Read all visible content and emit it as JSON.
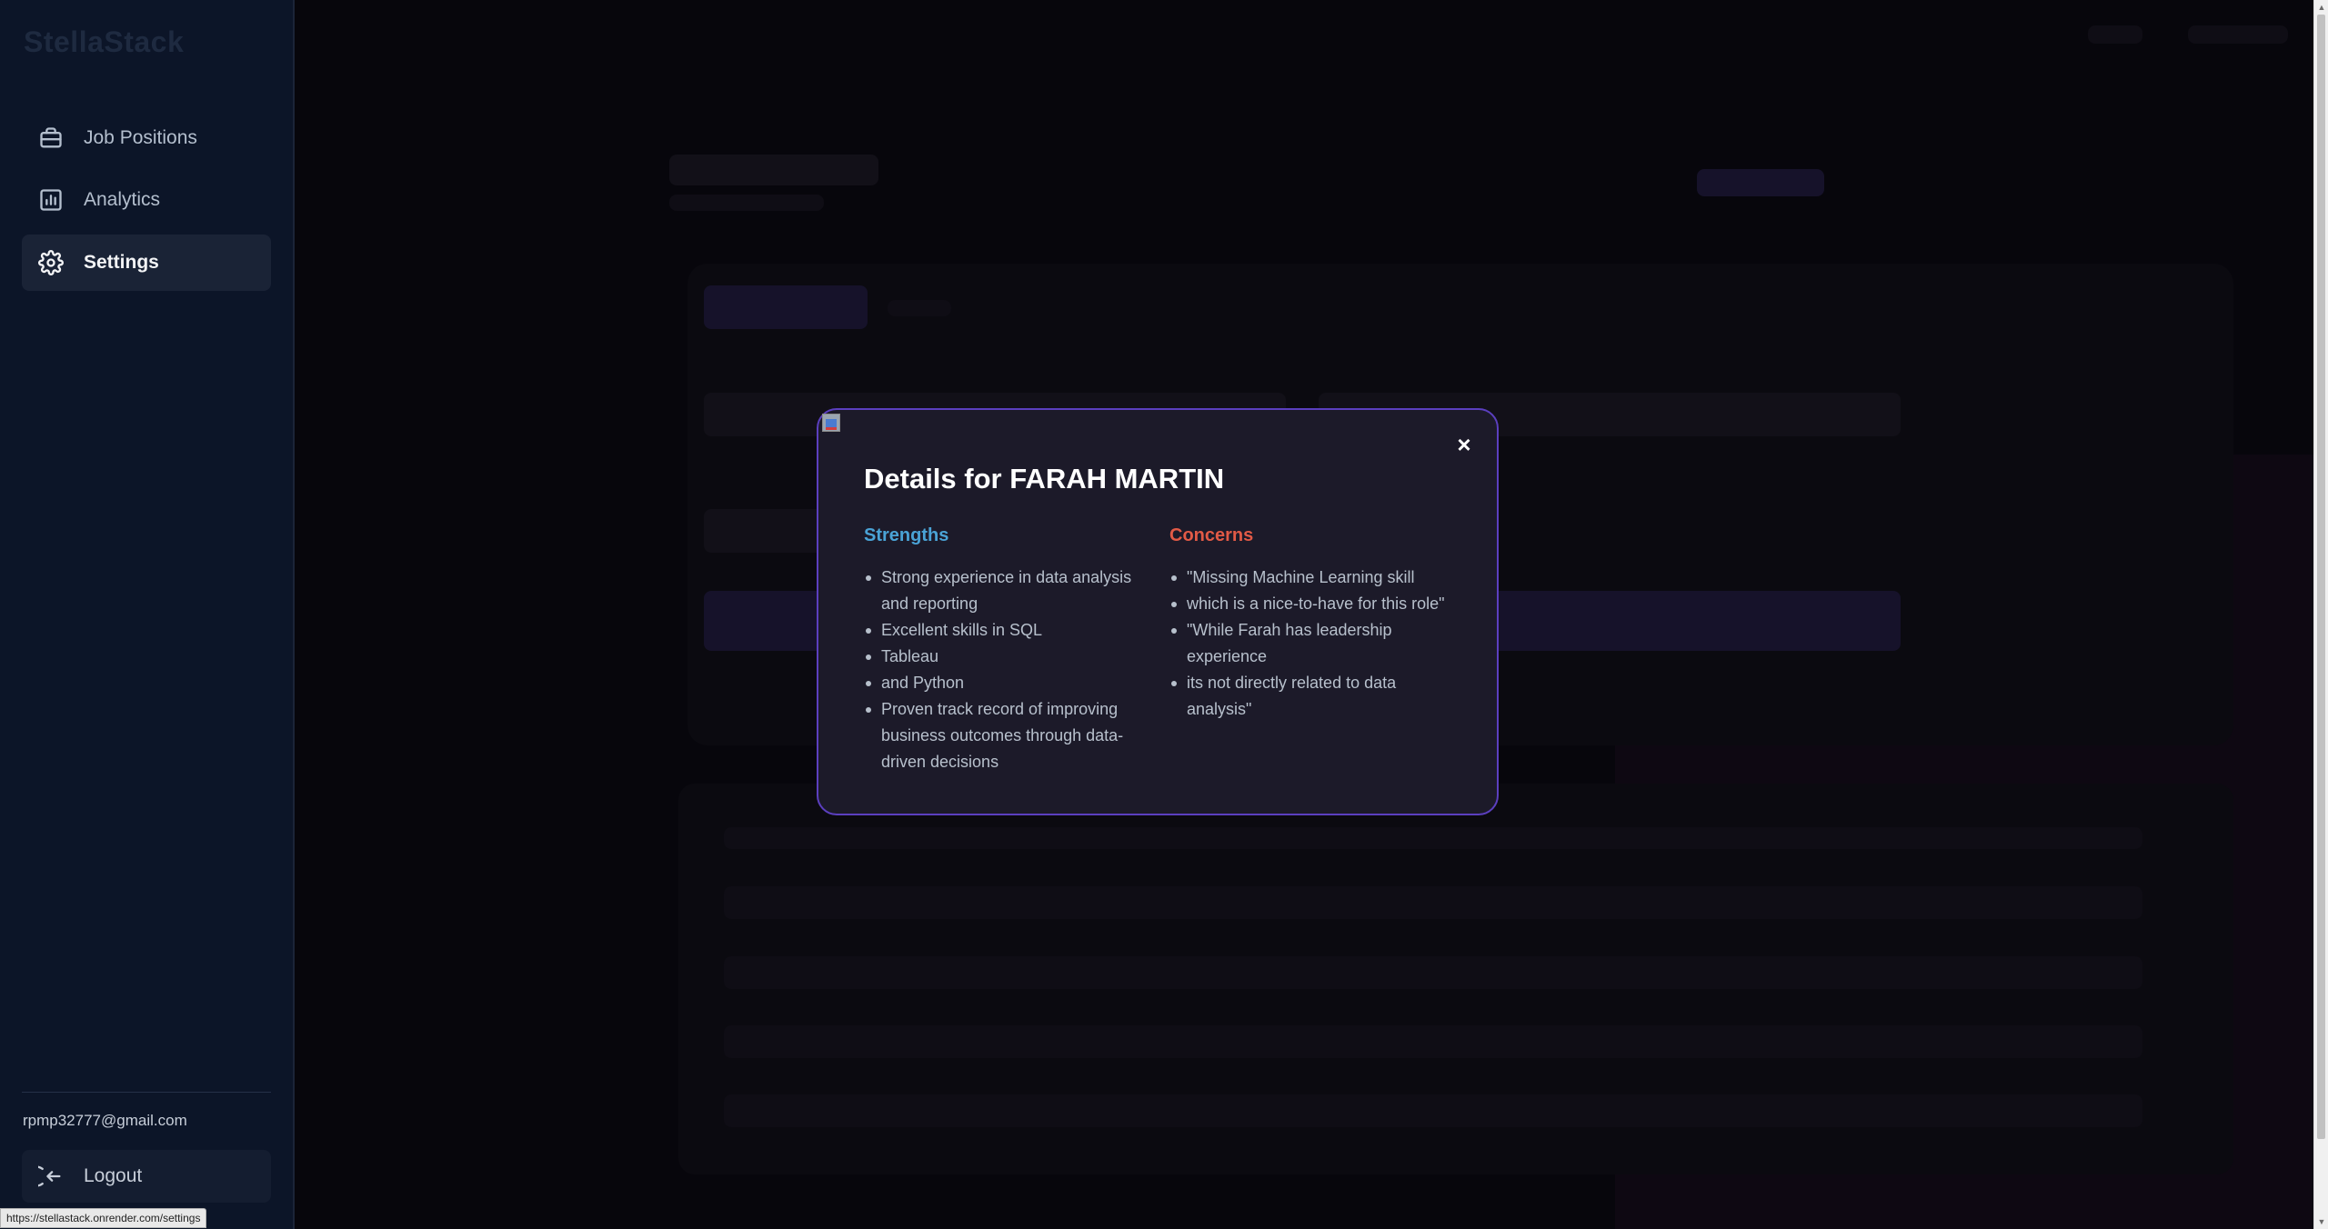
{
  "app": {
    "logo": "StellaStack"
  },
  "sidebar": {
    "items": [
      {
        "label": "Job Positions",
        "icon": "briefcase-icon"
      },
      {
        "label": "Analytics",
        "icon": "bar-chart-icon"
      },
      {
        "label": "Settings",
        "icon": "gear-icon",
        "active": true
      }
    ],
    "user_email": "rpmp32777@gmail.com",
    "logout_label": "Logout"
  },
  "modal": {
    "title": "Details for FARAH MARTIN",
    "close_symbol": "×",
    "strengths": {
      "heading": "Strengths",
      "items": [
        "Strong experience in data analysis and reporting",
        "Excellent skills in SQL",
        "Tableau",
        "and Python",
        "Proven track record of improving business outcomes through data-driven decisions"
      ]
    },
    "concerns": {
      "heading": "Concerns",
      "items": [
        "\"Missing Machine Learning skill",
        "which is a nice-to-have for this role\"",
        "\"While Farah has leadership experience",
        "its not directly related to data analysis\""
      ]
    }
  },
  "status_bar": {
    "url": "https://stellastack.onrender.com/settings"
  },
  "colors": {
    "sidebar_bg": "#0c1528",
    "modal_bg": "#1c1a29",
    "modal_border": "#5b3fbf",
    "strengths_heading": "#4aa3d6",
    "concerns_heading": "#e25a46"
  }
}
